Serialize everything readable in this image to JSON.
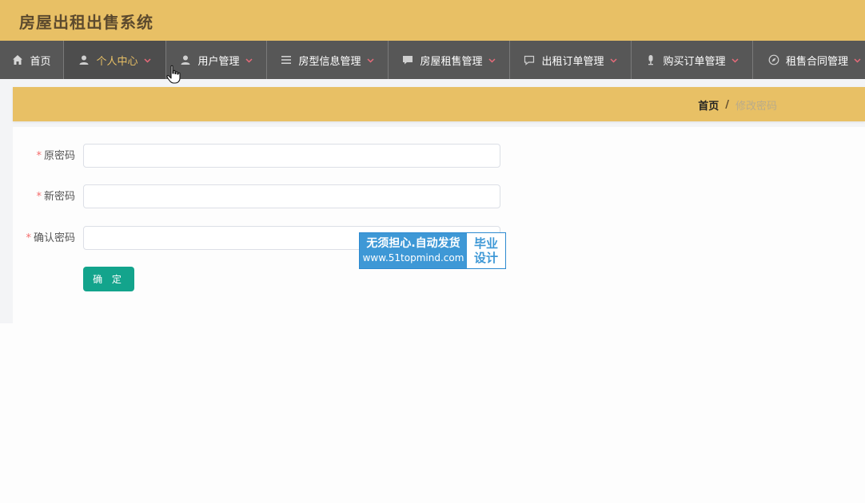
{
  "app": {
    "title": "房屋出租出售系统"
  },
  "nav": {
    "items": [
      {
        "label": "首页",
        "icon": "home-icon",
        "has_caret": false
      },
      {
        "label": "个人中心",
        "icon": "user-icon",
        "has_caret": true,
        "active": true
      },
      {
        "label": "用户管理",
        "icon": "user-icon",
        "has_caret": true
      },
      {
        "label": "房型信息管理",
        "icon": "list-icon",
        "has_caret": true
      },
      {
        "label": "房屋租售管理",
        "icon": "chat-icon",
        "has_caret": true
      },
      {
        "label": "出租订单管理",
        "icon": "chat-outline-icon",
        "has_caret": true
      },
      {
        "label": "购买订单管理",
        "icon": "mic-icon",
        "has_caret": true
      },
      {
        "label": "租售合同管理",
        "icon": "compass-icon",
        "has_caret": true
      }
    ]
  },
  "breadcrumb": {
    "home": "首页",
    "separator": "/",
    "current": "修改密码"
  },
  "form": {
    "old_password": {
      "label": "原密码",
      "required": "*",
      "value": ""
    },
    "new_password": {
      "label": "新密码",
      "required": "*",
      "value": ""
    },
    "confirm_password": {
      "label": "确认密码",
      "required": "*",
      "value": ""
    },
    "submit_label": "确 定"
  },
  "watermark": {
    "line1": "无须担心.自动发货",
    "line2": "www.51topmind.com",
    "tag_line1": "毕业",
    "tag_line2": "设计"
  },
  "colors": {
    "header_bg": "#e8c065",
    "nav_bg": "#575757",
    "active_text": "#e8c065",
    "caret": "#e86b7a",
    "primary_button": "#13a48c",
    "required_mark": "#f56c6c"
  }
}
